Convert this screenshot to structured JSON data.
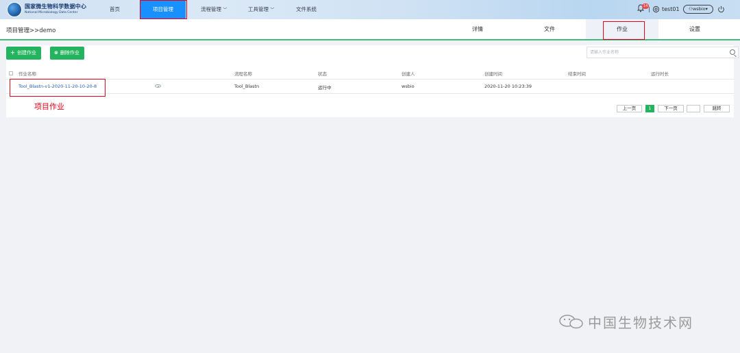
{
  "app": {
    "logo_title": "国家微生物科学数据中心",
    "logo_subtitle": "National Microbiology Data Center"
  },
  "nav": {
    "home": "首页",
    "project": "项目管理",
    "pipeline": "流程管理",
    "tools": "工具管理",
    "files": "文件系统"
  },
  "user": {
    "badge": "14",
    "name": "test01",
    "org": "wsbio"
  },
  "breadcrumb": "项目管理>>demo",
  "tabs": [
    "详情",
    "文件",
    "作业",
    "设置"
  ],
  "actions": {
    "create": "创建作业",
    "delete": "删除作业"
  },
  "search": {
    "placeholder": "请输入作业名称"
  },
  "table": {
    "headers": [
      "作业名称",
      "流程名称",
      "状态",
      "创建人",
      "创建时间",
      "结束时间",
      "运行时长"
    ],
    "rows": [
      {
        "name": "Tool_Blastn-v1-2020-11-20-10-20-8",
        "pipeline": "Tool_Blastn",
        "status": "运行中",
        "creator": "wsbio",
        "created": "2020-11-20 10:23:39",
        "ended": "",
        "duration": ""
      }
    ]
  },
  "annotation": "项目作业",
  "pagination": {
    "prev": "上一页",
    "current": "1",
    "next": "下一页",
    "jump": "跳转"
  },
  "watermark": "中国生物技术网",
  "colors": {
    "primary": "#1890ff",
    "success": "#24b35e",
    "highlight": "#e60012",
    "tab_underline": "#42b983"
  }
}
